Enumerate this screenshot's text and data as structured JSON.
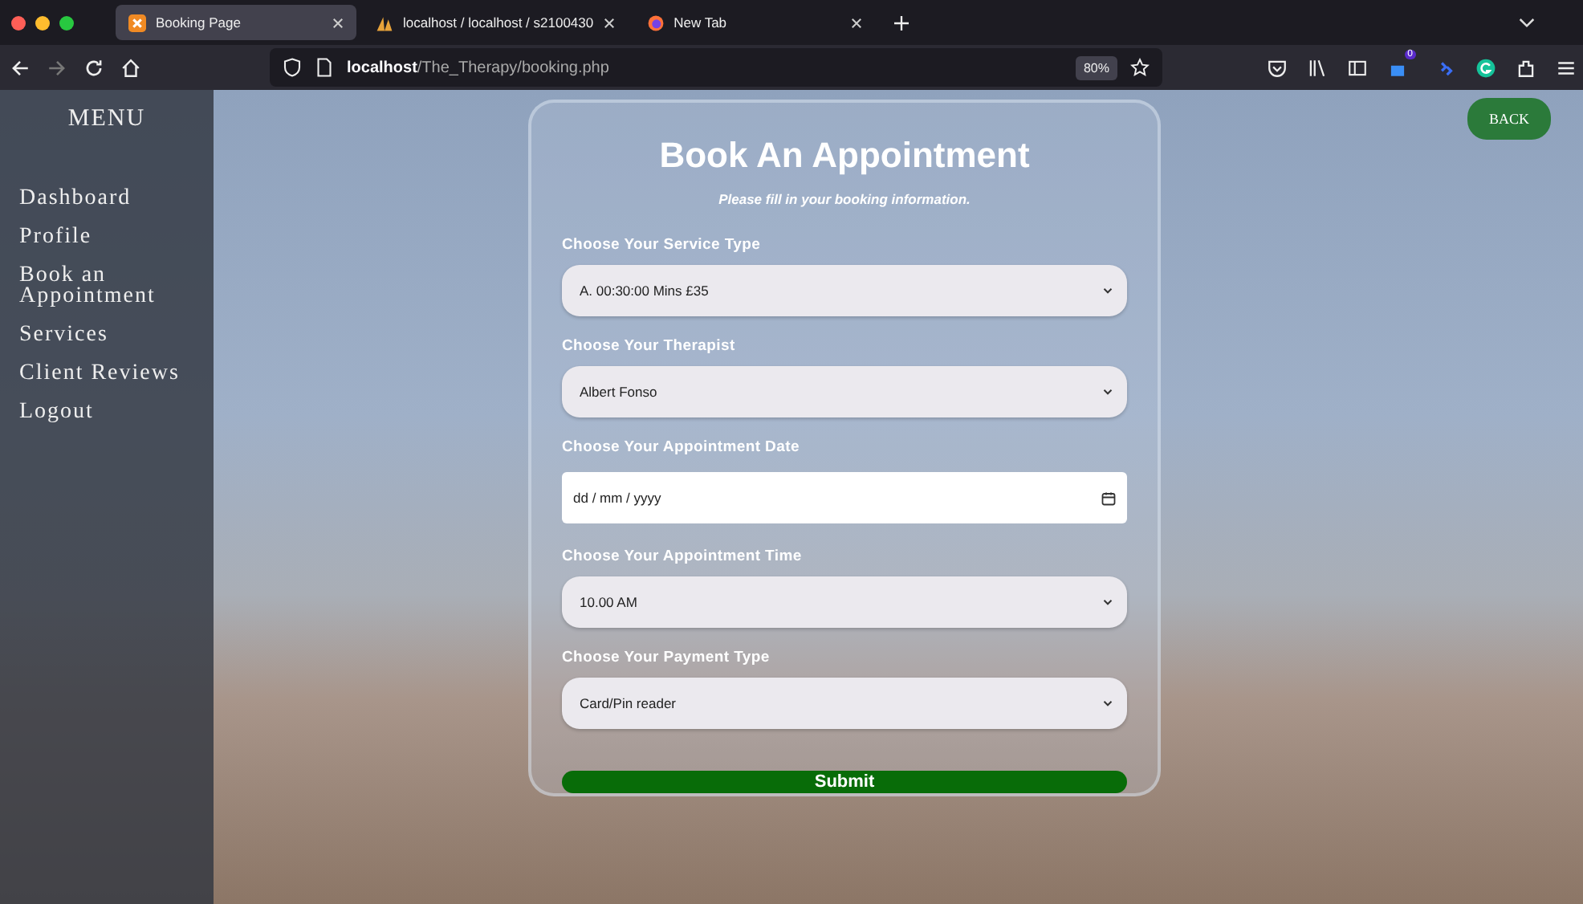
{
  "browser": {
    "tabs": [
      {
        "title": "Booking Page",
        "selected": true,
        "kind": "xampp"
      },
      {
        "title": "localhost / localhost / s2100430",
        "selected": false,
        "kind": "pma"
      },
      {
        "title": "New Tab",
        "selected": false,
        "kind": "firefox"
      }
    ],
    "url_host": "localhost",
    "url_path": "/The_Therapy/booking.php",
    "zoom": "80%",
    "extension_badge": "0"
  },
  "sidebar": {
    "title": "MENU",
    "items": [
      "Dashboard",
      "Profile",
      "Book an Appointment",
      "Services",
      "Client Reviews",
      "Logout"
    ]
  },
  "back_button": "BACK",
  "form": {
    "title": "Book An Appointment",
    "subtitle": "Please fill in your booking information.",
    "fields": [
      {
        "label": "Choose Your Service Type",
        "kind": "select",
        "value": "A. 00:30:00 Mins £35"
      },
      {
        "label": "Choose Your Therapist",
        "kind": "select",
        "value": "Albert Fonso"
      },
      {
        "label": "Choose Your Appointment Date",
        "kind": "date",
        "placeholder": "dd / mm / yyyy"
      },
      {
        "label": "Choose Your Appointment Time",
        "kind": "select",
        "value": "10.00 AM"
      },
      {
        "label": "Choose Your Payment Type",
        "kind": "select",
        "value": "Card/Pin reader"
      }
    ],
    "submit": "Submit"
  }
}
